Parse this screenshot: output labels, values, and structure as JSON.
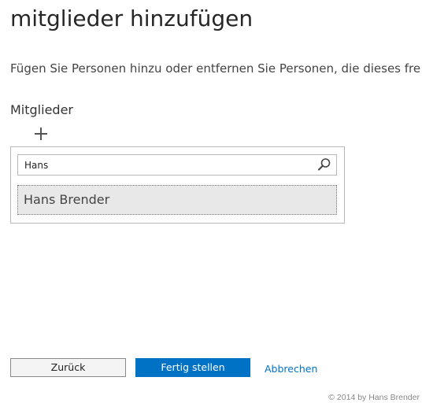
{
  "header": {
    "title": "mitglieder hinzufügen",
    "description": "Fügen Sie Personen hinzu oder entfernen Sie Personen, die dieses fre"
  },
  "members": {
    "label": "Mitglieder",
    "add_icon": "plus-icon",
    "search": {
      "value": "Hans",
      "placeholder": "",
      "icon": "search-icon"
    },
    "results": [
      {
        "name": "Hans Brender"
      }
    ]
  },
  "footer": {
    "back_label": "Zurück",
    "finish_label": "Fertig stellen",
    "cancel_label": "Abbrechen",
    "copyright": "© 2014 by Hans Brender"
  },
  "colors": {
    "accent": "#0072c6",
    "selection_bg": "#e8e8e8"
  }
}
